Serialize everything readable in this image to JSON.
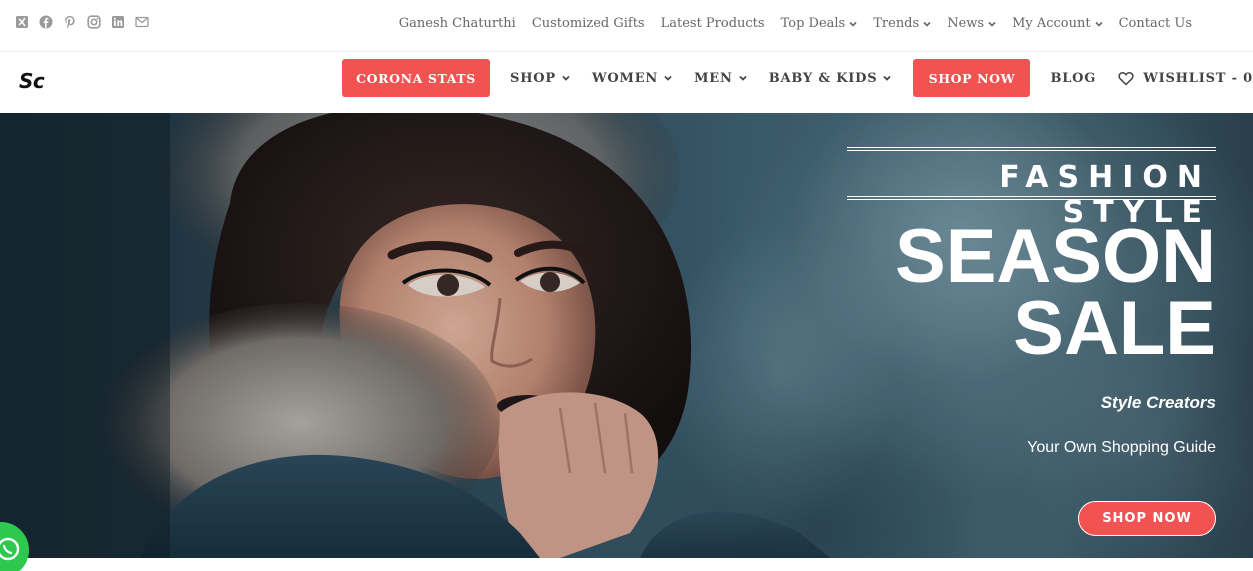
{
  "topbar": {
    "social_icons": [
      "xing-icon",
      "facebook-icon",
      "pinterest-icon",
      "instagram-icon",
      "linkedin-icon",
      "email-icon"
    ],
    "links": [
      {
        "label": "Ganesh Chaturthi",
        "dropdown": false
      },
      {
        "label": "Customized Gifts",
        "dropdown": false
      },
      {
        "label": "Latest Products",
        "dropdown": false
      },
      {
        "label": "Top Deals",
        "dropdown": true
      },
      {
        "label": "Trends",
        "dropdown": true
      },
      {
        "label": "News",
        "dropdown": true
      },
      {
        "label": "My Account",
        "dropdown": true
      },
      {
        "label": "Contact Us",
        "dropdown": false
      }
    ]
  },
  "header": {
    "logo": "Sc",
    "nav": {
      "corona": "CORONA STATS",
      "shop": "SHOP",
      "women": "WOMEN",
      "men": "MEN",
      "baby_kids": "BABY & KIDS",
      "shop_now": "SHOP NOW",
      "blog": "BLOG",
      "wishlist": "WISHLIST - 0"
    }
  },
  "hero": {
    "kicker": "FASHION STYLE",
    "headline_line1": "SEASON",
    "headline_line2": "SALE",
    "tagline": "Style Creators",
    "subtitle": "Your Own Shopping Guide",
    "cta": "SHOP NOW"
  },
  "colors": {
    "accent": "#f35252",
    "whatsapp": "#2fc84f",
    "text_muted": "#666666"
  }
}
